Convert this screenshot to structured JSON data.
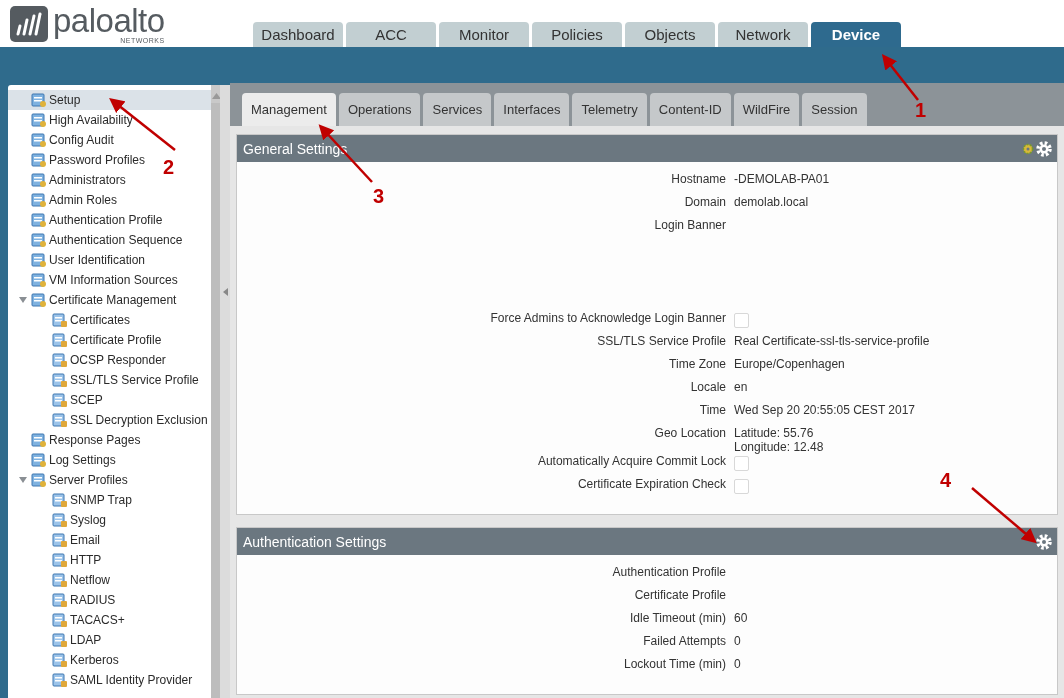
{
  "logo": {
    "name": "paloalto",
    "sub": "NETWORKS"
  },
  "top_tabs": [
    {
      "label": "Dashboard",
      "selected": false
    },
    {
      "label": "ACC",
      "selected": false
    },
    {
      "label": "Monitor",
      "selected": false
    },
    {
      "label": "Policies",
      "selected": false
    },
    {
      "label": "Objects",
      "selected": false
    },
    {
      "label": "Network",
      "selected": false
    },
    {
      "label": "Device",
      "selected": true
    }
  ],
  "sidebar": {
    "items": [
      {
        "label": "Setup",
        "selected": true
      },
      {
        "label": "High Availability",
        "selected": false
      },
      {
        "label": "Config Audit",
        "selected": false
      },
      {
        "label": "Password Profiles",
        "selected": false
      },
      {
        "label": "Administrators",
        "selected": false
      },
      {
        "label": "Admin Roles",
        "selected": false
      },
      {
        "label": "Authentication Profile",
        "selected": false
      },
      {
        "label": "Authentication Sequence",
        "selected": false
      },
      {
        "label": "User Identification",
        "selected": false
      },
      {
        "label": "VM Information Sources",
        "selected": false
      },
      {
        "label": "Certificate Management",
        "selected": false,
        "expanded": true,
        "children": [
          {
            "label": "Certificates",
            "selected": false
          },
          {
            "label": "Certificate Profile",
            "selected": false
          },
          {
            "label": "OCSP Responder",
            "selected": false
          },
          {
            "label": "SSL/TLS Service Profile",
            "selected": false
          },
          {
            "label": "SCEP",
            "selected": false
          },
          {
            "label": "SSL Decryption Exclusion",
            "selected": false
          }
        ]
      },
      {
        "label": "Response Pages",
        "selected": false
      },
      {
        "label": "Log Settings",
        "selected": false
      },
      {
        "label": "Server Profiles",
        "selected": false,
        "expanded": true,
        "children": [
          {
            "label": "SNMP Trap",
            "selected": false
          },
          {
            "label": "Syslog",
            "selected": false
          },
          {
            "label": "Email",
            "selected": false
          },
          {
            "label": "HTTP",
            "selected": false
          },
          {
            "label": "Netflow",
            "selected": false
          },
          {
            "label": "RADIUS",
            "selected": false
          },
          {
            "label": "TACACS+",
            "selected": false
          },
          {
            "label": "LDAP",
            "selected": false
          },
          {
            "label": "Kerberos",
            "selected": false
          },
          {
            "label": "SAML Identity Provider",
            "selected": false
          }
        ]
      }
    ]
  },
  "sub_tabs": [
    {
      "label": "Management",
      "selected": true
    },
    {
      "label": "Operations",
      "selected": false
    },
    {
      "label": "Services",
      "selected": false
    },
    {
      "label": "Interfaces",
      "selected": false
    },
    {
      "label": "Telemetry",
      "selected": false
    },
    {
      "label": "Content-ID",
      "selected": false
    },
    {
      "label": "WildFire",
      "selected": false
    },
    {
      "label": "Session",
      "selected": false
    }
  ],
  "panels": [
    {
      "title": "General Settings",
      "fields": [
        {
          "kind": "text",
          "label": "Hostname",
          "value": "-DEMOLAB-PA01"
        },
        {
          "kind": "text",
          "label": "Domain",
          "value": "demolab.local"
        },
        {
          "kind": "banner",
          "label": "Login Banner"
        },
        {
          "kind": "checkbox",
          "label": "Force Admins to Acknowledge Login Banner",
          "checked": false
        },
        {
          "kind": "text",
          "label": "SSL/TLS Service Profile",
          "value": "Real Certificate-ssl-tls-service-profile"
        },
        {
          "kind": "text",
          "label": "Time Zone",
          "value": "Europe/Copenhagen"
        },
        {
          "kind": "text",
          "label": "Locale",
          "value": "en"
        },
        {
          "kind": "text",
          "label": "Time",
          "value": "Wed Sep 20 20:55:05 CEST 2017"
        },
        {
          "kind": "lines",
          "label": "Geo Location",
          "lines": [
            "Latitude: 55.76",
            "Longitude: 12.48"
          ]
        },
        {
          "kind": "checkbox",
          "label": "Automatically Acquire Commit Lock",
          "checked": false
        },
        {
          "kind": "checkbox",
          "label": "Certificate Expiration Check",
          "checked": false
        }
      ],
      "extra_icon": true
    },
    {
      "title": "Authentication Settings",
      "fields": [
        {
          "kind": "text",
          "label": "Authentication Profile"
        },
        {
          "kind": "text",
          "label": "Certificate Profile"
        },
        {
          "kind": "text",
          "label": "Idle Timeout (min)",
          "value": "60"
        },
        {
          "kind": "text",
          "label": "Failed Attempts",
          "value": "0"
        },
        {
          "kind": "text",
          "label": "Lockout Time (min)",
          "value": "0"
        }
      ],
      "extra_icon": false
    }
  ],
  "annotations": [
    {
      "label": "1"
    },
    {
      "label": "2"
    },
    {
      "label": "3"
    },
    {
      "label": "4"
    }
  ]
}
